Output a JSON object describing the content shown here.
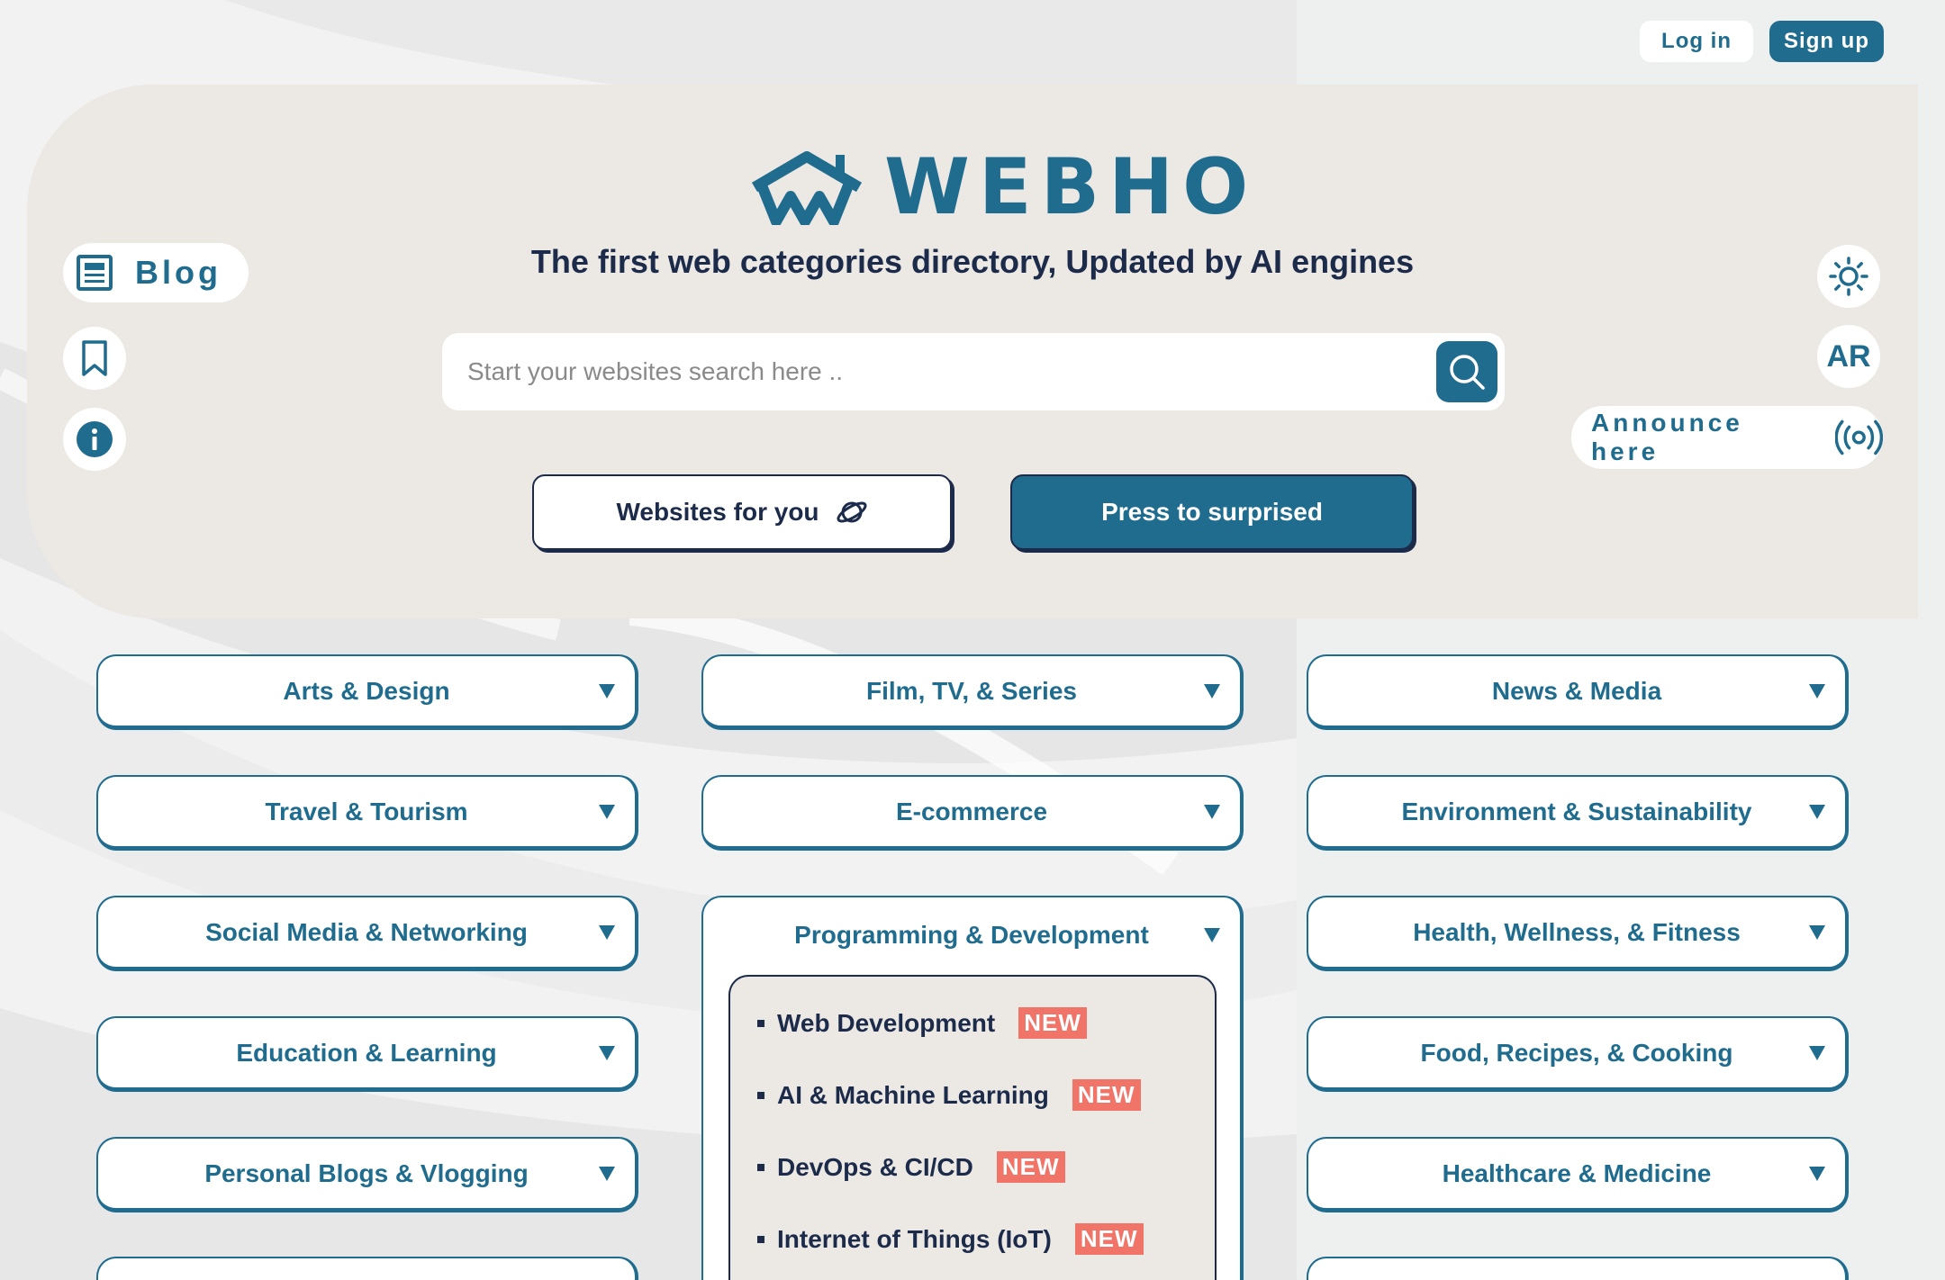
{
  "header": {
    "login_label": "Log in",
    "signup_label": "Sign up"
  },
  "brand": {
    "name": "WEBHO",
    "tagline": "The first web categories directory, Updated by AI engines"
  },
  "left_tools": {
    "blog_label": "Blog"
  },
  "right_tools": {
    "language_label": "AR",
    "announce_label": "Announce here"
  },
  "search": {
    "placeholder": "Start your websites search here .."
  },
  "actions": {
    "websites_for_you": "Websites for you",
    "surprise": "Press to surprised"
  },
  "categories": {
    "col1": [
      "Arts & Design",
      "Travel & Tourism",
      "Social Media & Networking",
      "Education & Learning",
      "Personal Blogs & Vlogging"
    ],
    "col2": [
      "Film, TV, & Series",
      "E-commerce"
    ],
    "open": {
      "title": "Programming & Development",
      "items": [
        {
          "label": "Web Development",
          "badge": "NEW"
        },
        {
          "label": "AI & Machine Learning",
          "badge": "NEW"
        },
        {
          "label": "DevOps & CI/CD",
          "badge": "NEW"
        },
        {
          "label": "Internet of Things (IoT)",
          "badge": "NEW"
        }
      ]
    },
    "col3": [
      "News & Media",
      "Environment & Sustainability",
      "Health, Wellness, & Fitness",
      "Food, Recipes, & Cooking",
      "Healthcare & Medicine"
    ]
  },
  "colors": {
    "primary": "#1f6c8e",
    "dark": "#1c2b4a",
    "hero_bg": "#ece8e4",
    "badge": "#f07468"
  }
}
